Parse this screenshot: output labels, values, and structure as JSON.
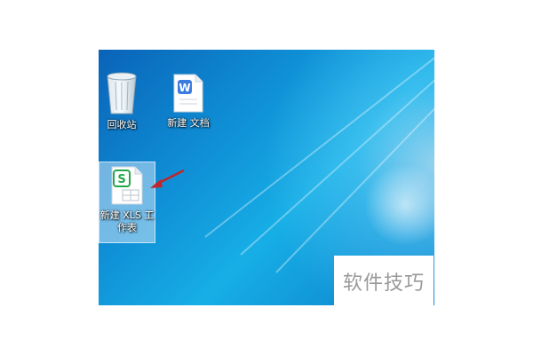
{
  "desktop": {
    "icons": [
      {
        "name": "recycle-bin",
        "label": "回收站",
        "icon": "recycle-bin-icon"
      },
      {
        "name": "wps-word-doc",
        "label": "新建 文档",
        "icon": "wps-writer-icon",
        "badge": "W"
      },
      {
        "name": "wps-xls-sheet",
        "label": "新建 XLS 工\n作表",
        "icon": "wps-spreadsheet-icon",
        "badge": "S"
      }
    ],
    "watermark": "软件技巧"
  },
  "colors": {
    "accent_red": "#c0262b",
    "writer_blue": "#3b7be0",
    "sheet_green": "#22a84a"
  }
}
